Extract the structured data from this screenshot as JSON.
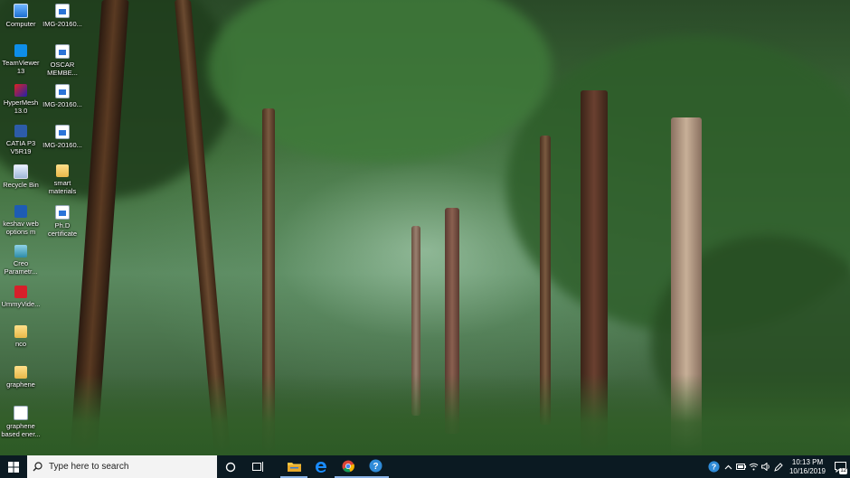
{
  "desktop_icons": [
    {
      "label": "Computer",
      "icon": "computer-icon"
    },
    {
      "label": "IMG-20160...",
      "icon": "image-file-icon"
    },
    {
      "label": "TeamViewer 13",
      "icon": "teamviewer-icon"
    },
    {
      "label": "OSCAR MEMBE...",
      "icon": "image-file-icon"
    },
    {
      "label": "HyperMesh 13.0",
      "icon": "hypermesh-icon"
    },
    {
      "label": "IMG-20160...",
      "icon": "image-file-icon"
    },
    {
      "label": "CATIA P3 V5R19",
      "icon": "catia-icon"
    },
    {
      "label": "IMG-20160...",
      "icon": "image-file-icon"
    },
    {
      "label": "Recycle Bin",
      "icon": "recycle-bin-icon"
    },
    {
      "label": "smart materials",
      "icon": "folder-icon"
    },
    {
      "label": "keshav web options m",
      "icon": "word-doc-icon"
    },
    {
      "label": "Ph.D certificate",
      "icon": "image-file-icon"
    },
    {
      "label": "Creo Parametr...",
      "icon": "creo-icon"
    },
    {
      "label": "UmmyVide...",
      "icon": "ummy-video-icon"
    },
    {
      "label": "nco",
      "icon": "folder-icon"
    },
    {
      "label": "graphene",
      "icon": "folder-icon"
    },
    {
      "label": "graphene based ener...",
      "icon": "document-icon"
    }
  ],
  "taskbar": {
    "search_placeholder": "Type here to search",
    "apps": [
      {
        "name": "Cortana",
        "icon": "cortana-icon"
      },
      {
        "name": "Task View",
        "icon": "task-view-icon"
      },
      {
        "name": "File Explorer",
        "icon": "file-explorer-icon"
      },
      {
        "name": "Microsoft Edge",
        "icon": "edge-icon"
      },
      {
        "name": "Google Chrome",
        "icon": "chrome-icon"
      },
      {
        "name": "Get Help",
        "icon": "help-icon"
      }
    ],
    "clock_time": "10:13 PM",
    "clock_date": "10/16/2019",
    "notification_count": "12"
  },
  "colors": {
    "taskbar_bg": "#0b1a22",
    "accent": "#8ab4e8"
  }
}
